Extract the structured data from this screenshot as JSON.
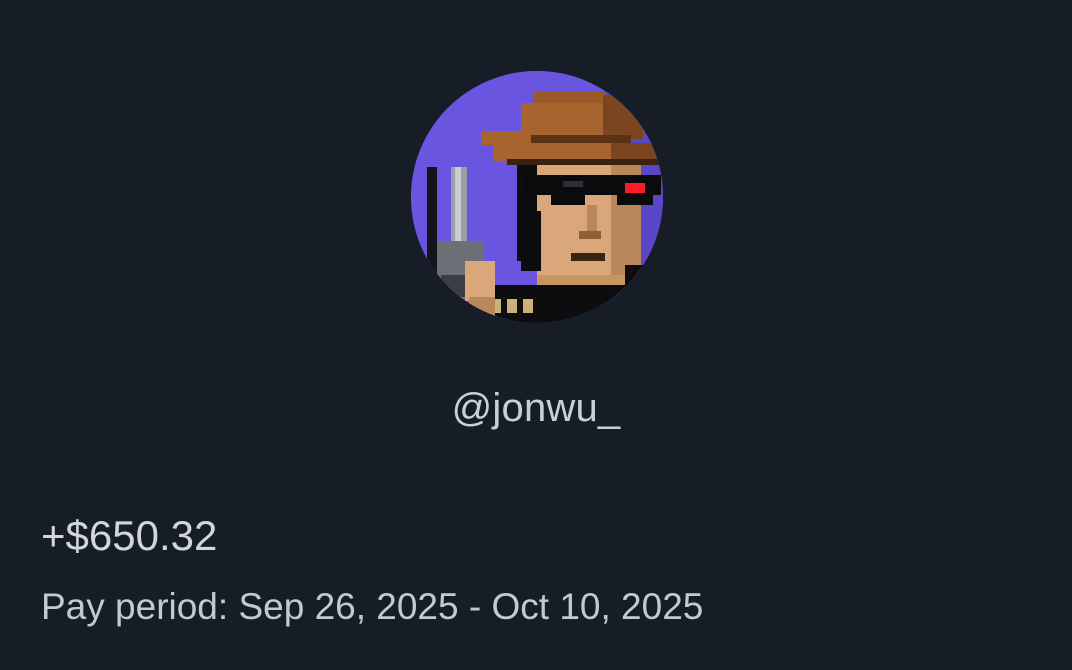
{
  "profile": {
    "handle": "@jonwu_",
    "avatar_icon": "pixel-cowboy-avatar",
    "avatar_bg": "#6a55e0"
  },
  "earnings": {
    "amount": "+$650.32",
    "period_label": "Pay period:",
    "period_start": "Sep 26, 2025",
    "period_separator": "-",
    "period_end": "Oct 10, 2025"
  },
  "theme": {
    "background": "#161d27",
    "text": "#d1d6dd"
  }
}
